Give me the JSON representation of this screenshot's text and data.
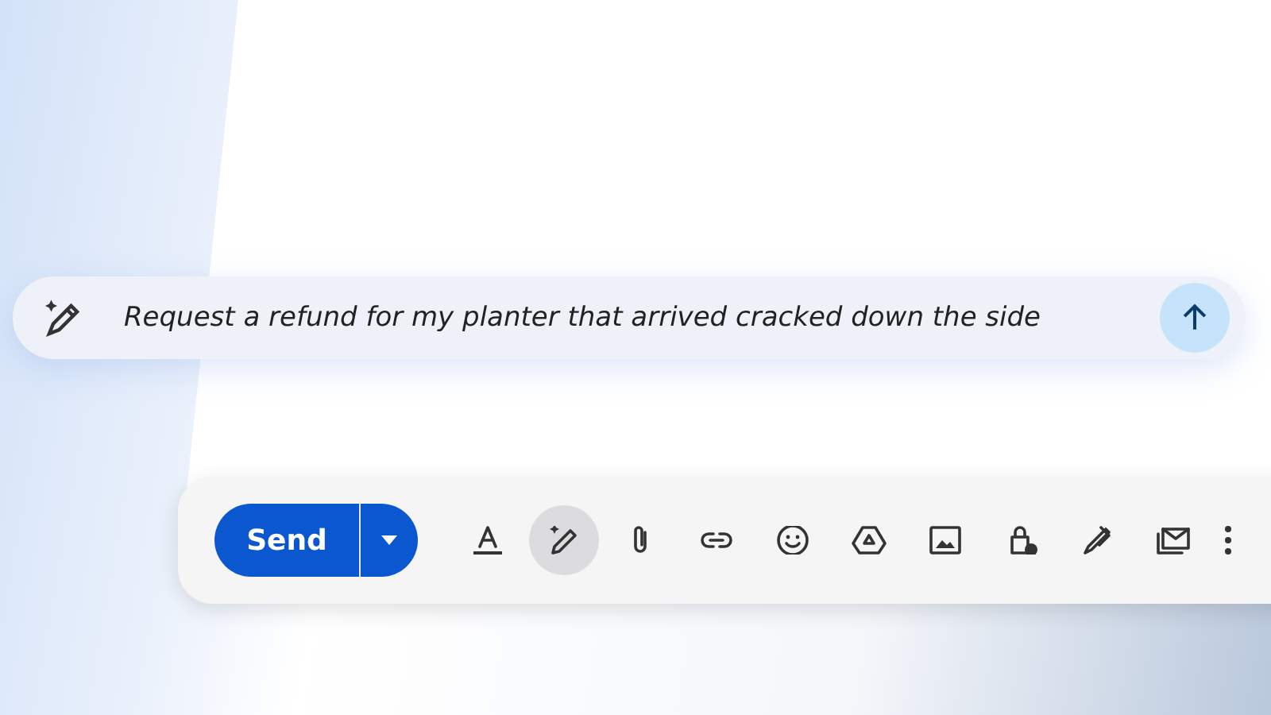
{
  "prompt": {
    "value": "Request a refund for my planter that arrived cracked down the side"
  },
  "send": {
    "label": "Send"
  },
  "toolbar": [
    {
      "kind": "format",
      "selected": false
    },
    {
      "kind": "write",
      "selected": true
    },
    {
      "kind": "attach",
      "selected": false
    },
    {
      "kind": "link",
      "selected": false
    },
    {
      "kind": "emoji",
      "selected": false
    },
    {
      "kind": "drive",
      "selected": false
    },
    {
      "kind": "photo",
      "selected": false
    },
    {
      "kind": "lock",
      "selected": false
    },
    {
      "kind": "signature",
      "selected": false
    },
    {
      "kind": "template",
      "selected": false
    },
    {
      "kind": "more",
      "selected": false
    }
  ]
}
